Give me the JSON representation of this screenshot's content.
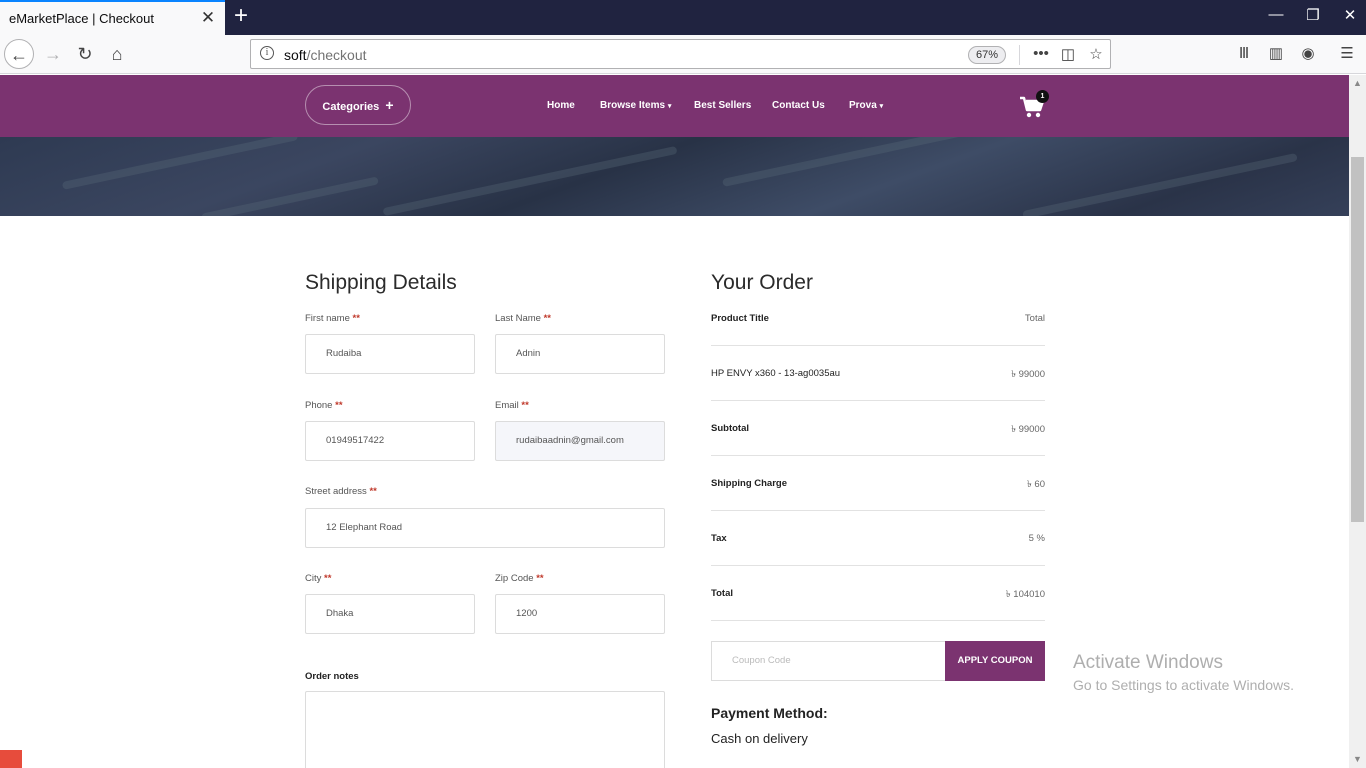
{
  "browser": {
    "tab_title": "eMarketPlace | Checkout",
    "url_host": "soft",
    "url_path": "/checkout",
    "zoom": "67%"
  },
  "site_nav": {
    "categories_label": "Categories",
    "menu": [
      {
        "label": "Home",
        "has_caret": false
      },
      {
        "label": "Browse Items",
        "has_caret": true
      },
      {
        "label": "Best Sellers",
        "has_caret": false
      },
      {
        "label": "Contact Us",
        "has_caret": false
      },
      {
        "label": "Prova",
        "has_caret": true
      }
    ],
    "cart_count": "1",
    "accent_color": "#7b3370"
  },
  "shipping": {
    "title": "Shipping Details",
    "first_name_label": "First name",
    "first_name_value": "Rudaiba",
    "last_name_label": "Last Name",
    "last_name_value": "Adnin",
    "phone_label": "Phone",
    "phone_value": "01949517422",
    "email_label": "Email",
    "email_value": "rudaibaadnin@gmail.com",
    "street_label": "Street address",
    "street_value": "12 Elephant Road",
    "city_label": "City",
    "city_value": "Dhaka",
    "zip_label": "Zip Code",
    "zip_value": "1200",
    "required_mark": "**",
    "notes_label": "Order notes"
  },
  "order": {
    "title": "Your Order",
    "header_left": "Product Title",
    "header_right": "Total",
    "rows": [
      {
        "label": "HP ENVY x360 - 13-ag0035au",
        "value": "৳ 99000"
      },
      {
        "label": "Subtotal",
        "value": "৳ 99000"
      },
      {
        "label": "Shipping Charge",
        "value": "৳ 60"
      },
      {
        "label": "Tax",
        "value": "5 %"
      },
      {
        "label": "Total",
        "value": "৳ 104010"
      }
    ],
    "coupon_placeholder": "Coupon Code",
    "coupon_button": "APPLY COUPON",
    "payment_title": "Payment Method:",
    "payment_value": "Cash on delivery"
  },
  "os_watermark": {
    "line1": "Activate Windows",
    "line2": "Go to Settings to activate Windows."
  }
}
